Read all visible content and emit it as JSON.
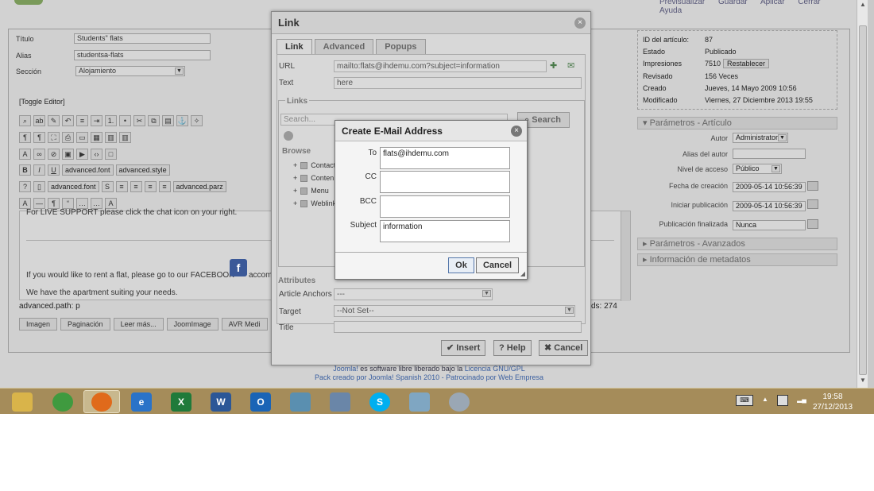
{
  "top_links": [
    "Previsualizar",
    "Guardar",
    "Aplicar",
    "Cerrar",
    "Ayuda"
  ],
  "article_form": {
    "titulo_label": "Título",
    "titulo_value": "Students\" flats",
    "alias_label": "Alias",
    "alias_value": "studentsa-flats",
    "seccion_label": "Sección",
    "seccion_value": "Alojamiento",
    "toggle_editor": "[Toggle Editor]"
  },
  "editor_toolbar": {
    "font_family": "advanced.font",
    "font_style": "advanced.style",
    "font_size": "advanced.font",
    "paragraph": "advanced.parz"
  },
  "editor_content": {
    "line1": "For LIVE SUPPORT please click the chat icon on your right.",
    "line2": "If you would like to rent a flat, please go to our FACEBOOK",
    "line2_tail": "accom",
    "line3": "We have the apartment suiting your needs.",
    "path": "advanced.path:  p",
    "words": "ds: 274"
  },
  "editor_buttons": [
    "Imagen",
    "Paginación",
    "Leer más...",
    "JoomImage",
    "AVR Medi"
  ],
  "article_info": {
    "rows": [
      {
        "label": "ID del artículo:",
        "value": "87"
      },
      {
        "label": "Estado",
        "value": "Publicado"
      },
      {
        "label": "Impresiones",
        "value": "7510"
      },
      {
        "label": "Revisado",
        "value": "156 Veces"
      },
      {
        "label": "Creado",
        "value": "Jueves, 14 Mayo 2009 10:56"
      },
      {
        "label": "Modificado",
        "value": "Viernes, 27 Diciembre 2013 19:55"
      }
    ],
    "reset_button": "Restablecer"
  },
  "params": {
    "header": "Parámetros - Artículo",
    "autor_label": "Autor",
    "autor_value": "Administrator",
    "alias_autor_label": "Alias del autor",
    "alias_autor_value": "",
    "nivel_label": "Nivel de acceso",
    "nivel_value": "Público",
    "fecha_label": "Fecha de creación",
    "fecha_value": "2009-05-14 10:56:39",
    "inicio_label": "Iniciar publicación",
    "inicio_value": "2009-05-14 10:56:39",
    "fin_label": "Publicación finalizada",
    "fin_value": "Nunca",
    "advanced_header": "Parámetros - Avanzados",
    "meta_header": "Información de metadatos"
  },
  "footer": {
    "line1_a": "Joomla!",
    "line1_b": " es software libre liberado bajo la ",
    "line1_c": "Licencia GNU/GPL",
    "line2_a": "Pack creado por Joomla! Spanish 2010 - Patrocinado por ",
    "line2_b": "Web Empresa"
  },
  "link_dialog": {
    "title": "Link",
    "tabs": [
      "Link",
      "Advanced",
      "Popups"
    ],
    "url_label": "URL",
    "url_value": "mailto:flats@ihdemu.com?subject=information",
    "text_label": "Text",
    "text_value": "here",
    "links_legend": "Links",
    "search_placeholder": "Search...",
    "search_button": "Search",
    "browse_label": "Browse",
    "tree": [
      "Contact",
      "Conten",
      "Menu",
      "Weblink"
    ],
    "attributes_label": "Attributes",
    "anchors_label": "Article Anchors",
    "anchors_value": "---",
    "target_label": "Target",
    "target_value": "--Not Set--",
    "title_label": "Title",
    "insert_button": "Insert",
    "help_button": "Help",
    "cancel_button": "Cancel"
  },
  "email_dialog": {
    "title": "Create E-Mail Address",
    "to_label": "To",
    "to_value": "flats@ihdemu.com",
    "cc_label": "CC",
    "cc_value": "",
    "bcc_label": "BCC",
    "bcc_value": "",
    "subject_label": "Subject",
    "subject_value": "information",
    "ok_button": "Ok",
    "cancel_button": "Cancel"
  },
  "taskbar": {
    "apps": [
      {
        "name": "explorer",
        "label": "",
        "color": "#d9b44a"
      },
      {
        "name": "chrome",
        "label": "",
        "color": "#3f9a3f"
      },
      {
        "name": "firefox",
        "label": "",
        "color": "#e06a1b"
      },
      {
        "name": "internet-explorer",
        "label": "e",
        "color": "#2a73c8"
      },
      {
        "name": "excel",
        "label": "X",
        "color": "#1f7a3a"
      },
      {
        "name": "word",
        "label": "W",
        "color": "#2b5797"
      },
      {
        "name": "outlook",
        "label": "O",
        "color": "#1a64b6"
      },
      {
        "name": "network",
        "label": "",
        "color": "#5a8fb0"
      },
      {
        "name": "calculator",
        "label": "",
        "color": "#6a86a8"
      },
      {
        "name": "skype",
        "label": "S",
        "color": "#00aff0"
      },
      {
        "name": "notepad",
        "label": "",
        "color": "#7fa6c2"
      },
      {
        "name": "paint",
        "label": "",
        "color": "#9aa7b4"
      }
    ],
    "time": "19:58",
    "date": "27/12/2013"
  }
}
